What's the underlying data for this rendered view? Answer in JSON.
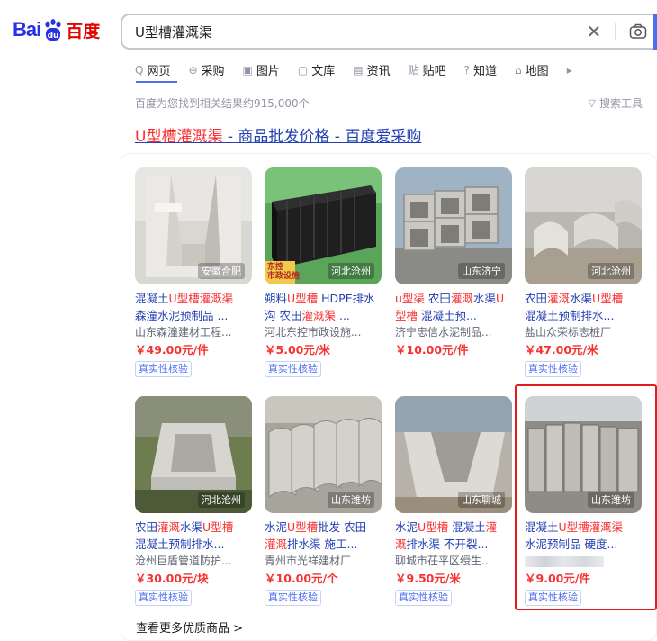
{
  "logo": {
    "part1": "Bai",
    "part2": "百度"
  },
  "search": {
    "query": "U型槽灌溉渠"
  },
  "tabs": [
    {
      "icon": "Q",
      "label": "网页"
    },
    {
      "icon": "⊕",
      "label": "采购"
    },
    {
      "icon": "▣",
      "label": "图片"
    },
    {
      "icon": "▢",
      "label": "文库"
    },
    {
      "icon": "▤",
      "label": "资讯"
    },
    {
      "icon": "贴",
      "label": "贴吧"
    },
    {
      "icon": "?",
      "label": "知道"
    },
    {
      "icon": "⌂",
      "label": "地图"
    },
    {
      "icon": "▸",
      "label": ""
    }
  ],
  "result_count": "百度为您找到相关结果约915,000个",
  "tools_label": "搜索工具",
  "result": {
    "title_hl": "U型槽灌溉渠",
    "title_rest": " - 商品批发价格 - 百度爱采购"
  },
  "products": [
    {
      "loc": "安徽合肥",
      "title_html": "混凝土<span class=\"hl\">U型槽灌溉渠</span><br>森潼水泥预制品 ...",
      "seller": "山东森潼建材工程...",
      "price": "￥49.00元/件",
      "badge": "真实性核验"
    },
    {
      "loc": "河北沧州",
      "title_html": "朔料<span class=\"hl\">U型槽</span> HDPE排水<br>沟 农田<span class=\"hl\">灌溉渠</span> ...",
      "seller": "河北东控市政设施...",
      "price": "￥5.00元/米",
      "badge": "真实性核验"
    },
    {
      "loc": "山东济宁",
      "title_html": "<span class=\"hl\">u型渠</span> 农田<span class=\"hl\">灌溉</span>水渠<span class=\"hl\">U</span><br><span class=\"hl\">型槽</span> 混凝土预...",
      "seller": "济宁忠信水泥制品...",
      "price": "￥10.00元/件",
      "badge": ""
    },
    {
      "loc": "河北沧州",
      "title_html": "农田<span class=\"hl\">灌溉</span>水渠<span class=\"hl\">U型槽</span><br>混凝土预制排水...",
      "seller": "盐山众荣标志桩厂",
      "price": "￥47.00元/米",
      "badge": "真实性核验"
    },
    {
      "loc": "河北沧州",
      "title_html": "农田<span class=\"hl\">灌溉</span>水渠<span class=\"hl\">U型槽</span><br>混凝土预制排水...",
      "seller": "沧州巨盾管道防护...",
      "price": "￥30.00元/块",
      "badge": "真实性核验"
    },
    {
      "loc": "山东潍坊",
      "title_html": "水泥<span class=\"hl\">U型槽</span>批发 农田<br><span class=\"hl\">灌溉</span>排水渠 施工...",
      "seller": "青州市光祥建材厂",
      "price": "￥10.00元/个",
      "badge": "真实性核验"
    },
    {
      "loc": "山东聊城",
      "title_html": "水泥<span class=\"hl\">U型槽</span> 混凝土<span class=\"hl\">灌</span><br><span class=\"hl\">溉</span>排水渠 不开裂...",
      "seller": "聊城市茌平区绶生...",
      "price": "￥9.50元/米",
      "badge": "真实性核验"
    },
    {
      "loc": "山东潍坊",
      "title_html": "混凝土<span class=\"hl\">U型槽灌溉渠</span><br>水泥预制品 硬度...",
      "seller": "",
      "price": "￥9.00元/件",
      "badge": "真实性核验"
    }
  ],
  "thumb_text": {
    "item1_label": "东控\n市政设施"
  },
  "more_label": "查看更多优质商品 >"
}
